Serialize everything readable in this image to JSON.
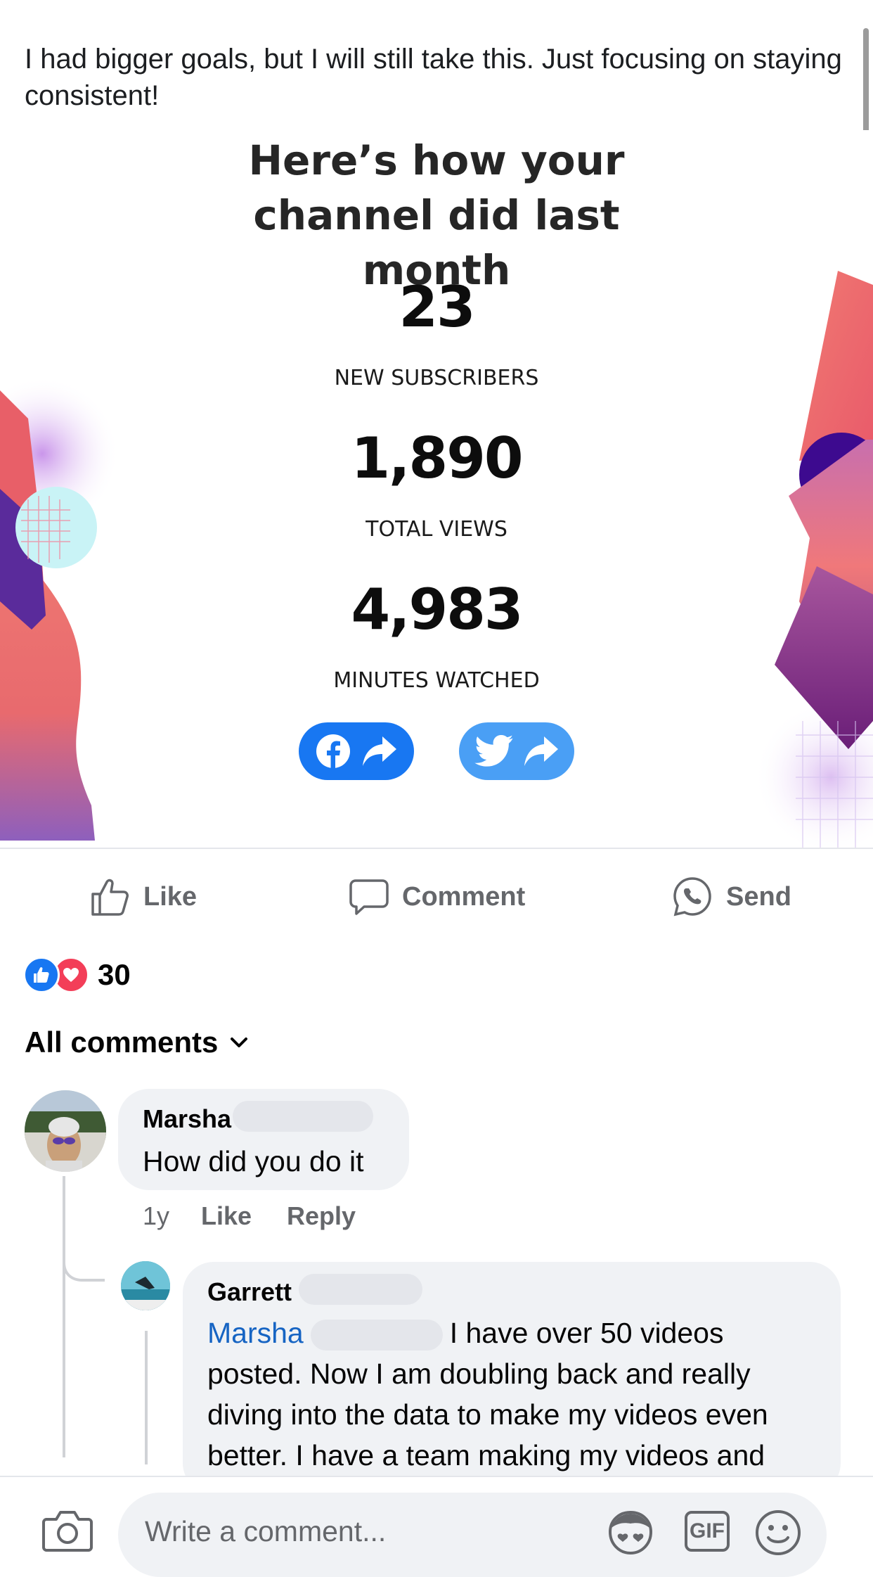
{
  "post": {
    "text": "I had bigger goals, but I will still take this.  Just focusing on staying consistent!"
  },
  "card": {
    "title": "Here’s how your channel did last month",
    "stats": [
      {
        "value": "23",
        "label": "NEW SUBSCRIBERS"
      },
      {
        "value": "1,890",
        "label": "TOTAL VIEWS"
      },
      {
        "value": "4,983",
        "label": "MINUTES WATCHED"
      }
    ],
    "share_buttons": [
      {
        "icon": "facebook-share-icon",
        "color": "#1877f2"
      },
      {
        "icon": "twitter-share-icon",
        "color": "#4a9ff5"
      }
    ]
  },
  "actions": {
    "like": "Like",
    "comment": "Comment",
    "send": "Send"
  },
  "reactions": {
    "count": "30",
    "icons": [
      "like-reaction-icon",
      "love-reaction-icon"
    ]
  },
  "comments_header": {
    "label": "All comments"
  },
  "comments": [
    {
      "name": "Marsha",
      "text": "How did you do it",
      "time": "1y",
      "like": "Like",
      "reply": "Reply"
    }
  ],
  "replies": [
    {
      "name": "Garrett",
      "mention": "Marsha",
      "text_first": "I have over 50 videos",
      "text_rest": "posted. Now I am doubling back and really diving into the data to make my videos even better. I have a team making my videos and"
    }
  ],
  "composer": {
    "placeholder": "Write a comment...",
    "gif_label": "GIF"
  },
  "colors": {
    "accent": "#1877f2",
    "link": "#1664c3",
    "muted": "#65676b"
  }
}
